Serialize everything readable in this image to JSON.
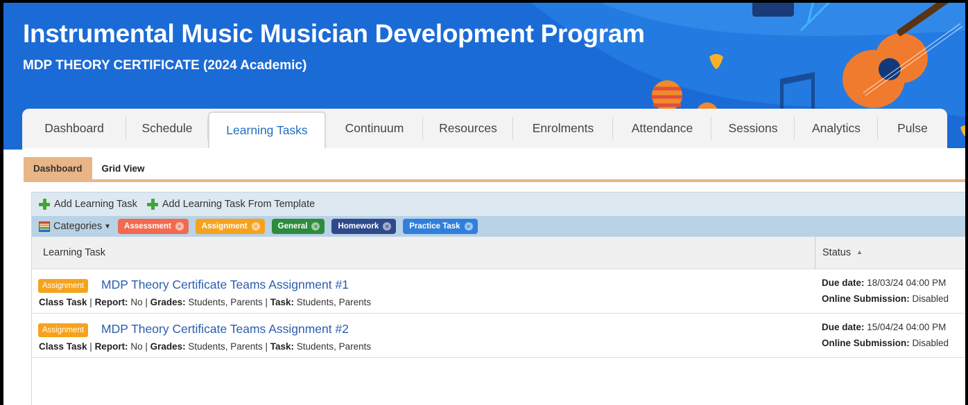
{
  "header": {
    "title": "Instrumental Music Musician Development Program",
    "subtitle": "MDP THEORY CERTIFICATE (2024 Academic)"
  },
  "tabs": [
    {
      "label": "Dashboard",
      "active": false
    },
    {
      "label": "Schedule",
      "active": false
    },
    {
      "label": "Learning Tasks",
      "active": true
    },
    {
      "label": "Continuum",
      "active": false
    },
    {
      "label": "Resources",
      "active": false
    },
    {
      "label": "Enrolments",
      "active": false
    },
    {
      "label": "Attendance",
      "active": false
    },
    {
      "label": "Sessions",
      "active": false
    },
    {
      "label": "Analytics",
      "active": false
    },
    {
      "label": "Pulse",
      "active": false
    }
  ],
  "subtabs": {
    "dashboard": "Dashboard",
    "grid_view": "Grid View"
  },
  "toolbar": {
    "add_task": "Add Learning Task",
    "add_from_template": "Add Learning Task From Template"
  },
  "categories": {
    "label": "Categories",
    "chips": [
      {
        "label": "Assessment",
        "color": "#f26a4f"
      },
      {
        "label": "Assignment",
        "color": "#f6a21d"
      },
      {
        "label": "General",
        "color": "#2e8b3e"
      },
      {
        "label": "Homework",
        "color": "#2f4a8a"
      },
      {
        "label": "Practice Task",
        "color": "#2f7fdd"
      }
    ]
  },
  "table": {
    "col_task": "Learning Task",
    "col_status": "Status",
    "rows": [
      {
        "badge": "Assignment",
        "title": "MDP Theory Certificate Teams Assignment #1",
        "class_task": "Class Task",
        "report_label": "Report:",
        "report_value": "No",
        "grades_label": "Grades:",
        "grades_value": "Students, Parents",
        "task_label": "Task:",
        "task_value": "Students, Parents",
        "due_label": "Due date:",
        "due_value": "18/03/24 04:00 PM",
        "online_label": "Online Submission:",
        "online_value": "Disabled"
      },
      {
        "badge": "Assignment",
        "title": "MDP Theory Certificate Teams Assignment #2",
        "class_task": "Class Task",
        "report_label": "Report:",
        "report_value": "No",
        "grades_label": "Grades:",
        "grades_value": "Students, Parents",
        "task_label": "Task:",
        "task_value": "Students, Parents",
        "due_label": "Due date:",
        "due_value": "15/04/24 04:00 PM",
        "online_label": "Online Submission:",
        "online_value": "Disabled"
      }
    ]
  },
  "colors": {
    "banner": "#1b6bd6",
    "active_tab_text": "#1f6fc5",
    "subtab_accent": "#e9b587",
    "task_link": "#2a5db0"
  }
}
